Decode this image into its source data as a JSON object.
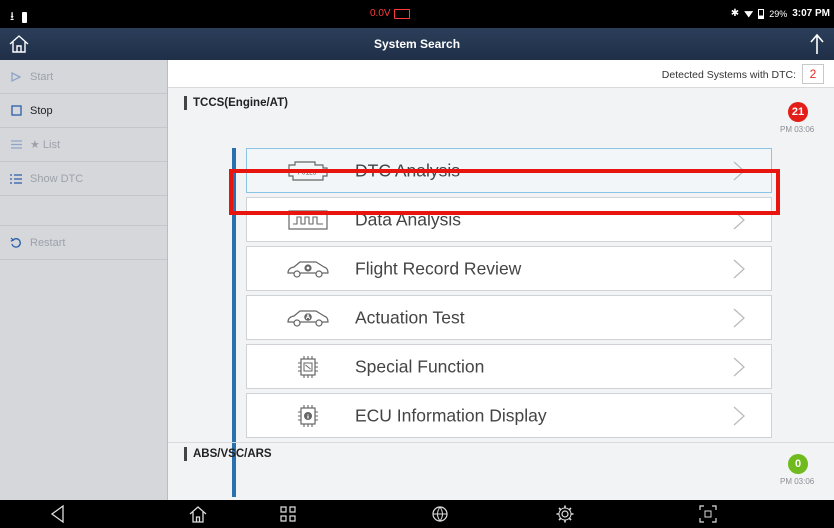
{
  "status_bar": {
    "voltage": "0.0V",
    "battery_percent": "29%",
    "time": "3:07 PM"
  },
  "header": {
    "title": "System Search"
  },
  "sidebar": {
    "items": [
      {
        "label": "Start",
        "icon": "play-icon",
        "enabled": false
      },
      {
        "label": "Stop",
        "icon": "square-icon",
        "enabled": true
      },
      {
        "label": "★ List",
        "icon": "list-icon",
        "enabled": false
      },
      {
        "label": "Show DTC",
        "icon": "dtc-list-icon",
        "enabled": false
      },
      {
        "label": "Restart",
        "icon": "restart-icon",
        "enabled": false
      }
    ]
  },
  "dtc_summary": {
    "label": "Detected Systems with DTC:",
    "count": "2"
  },
  "systems": [
    {
      "name": "TCCS(Engine/AT)",
      "dtc_count": "21",
      "time": "PM 03:06",
      "badge_color": "#e31d17"
    },
    {
      "name": "ABS/VSC/ARS",
      "dtc_count": "0",
      "time": "PM 03:06",
      "badge_color": "#6fba1d"
    }
  ],
  "functions": [
    {
      "label": "DTC Analysis",
      "icon": "engine-dtc-icon",
      "icon_text": "P0123"
    },
    {
      "label": "Data Analysis",
      "icon": "data-wave-icon"
    },
    {
      "label": "Flight Record Review",
      "icon": "car-record-icon"
    },
    {
      "label": "Actuation Test",
      "icon": "car-actuation-icon"
    },
    {
      "label": "Special Function",
      "icon": "chip-function-icon"
    },
    {
      "label": "ECU Information Display",
      "icon": "chip-info-icon"
    }
  ],
  "colors": {
    "accent_blue": "#2a6fae",
    "highlight_red": "#e8150f",
    "header_bg": "#1f2f48"
  }
}
